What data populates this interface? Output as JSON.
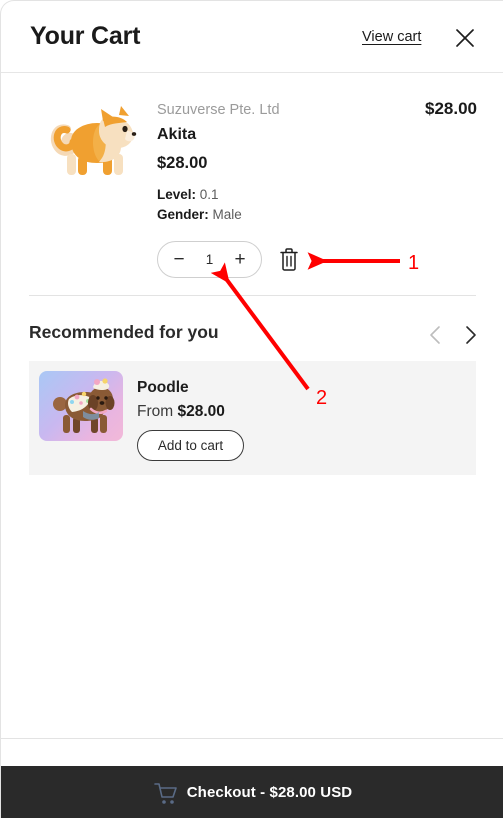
{
  "header": {
    "title": "Your Cart",
    "view_cart_label": "View cart",
    "close_icon": "close-icon"
  },
  "line_item": {
    "vendor": "Suzuverse Pte. Ltd",
    "title": "Akita",
    "unit_price": "$28.00",
    "line_price": "$28.00",
    "properties": [
      {
        "label": "Level:",
        "value": "0.1"
      },
      {
        "label": "Gender:",
        "value": "Male"
      }
    ],
    "quantity": {
      "decrease_label": "−",
      "value": "1",
      "increase_label": "+"
    },
    "remove_icon": "trash-icon",
    "image_alt": "akita-dog-image"
  },
  "recommendations": {
    "heading": "Recommended for you",
    "prev_icon": "chevron-left-icon",
    "next_icon": "chevron-right-icon",
    "card": {
      "title": "Poodle",
      "price_prefix": "From ",
      "price": "$28.00",
      "add_to_cart_label": "Add to cart",
      "image_alt": "poodle-dog-image"
    }
  },
  "footer": {
    "checkout_label": "Checkout - $28.00 USD",
    "cart_icon": "shopping-cart-icon"
  },
  "annotations": [
    {
      "label": "1",
      "target": "remove-button"
    },
    {
      "label": "2",
      "target": "qty-stepper"
    }
  ],
  "colors": {
    "accent_dark": "#2a2a2a",
    "annotation_red": "#ff0000",
    "card_background": "#f4f4f4",
    "muted_text": "#9b9b9b"
  }
}
